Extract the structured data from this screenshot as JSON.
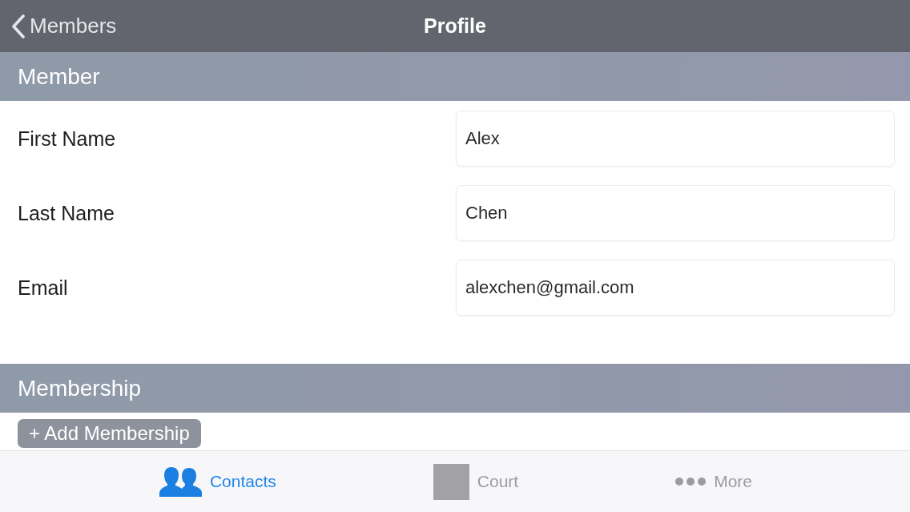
{
  "nav_bar": {
    "back_label": "Members",
    "title": "Profile"
  },
  "sections": [
    {
      "title": "Member",
      "fields": [
        {
          "label": "First Name",
          "value": "Alex"
        },
        {
          "label": "Last Name",
          "value": "Chen"
        },
        {
          "label": "Email",
          "value": "alexchen@gmail.com"
        }
      ]
    },
    {
      "title": "Membership",
      "buttons": [
        "+ Add Membership"
      ]
    }
  ],
  "tab_bar": [
    {
      "label": "Contacts",
      "selected": true
    },
    {
      "label": "Court",
      "selected": false
    },
    {
      "label": "More",
      "selected": false
    }
  ]
}
